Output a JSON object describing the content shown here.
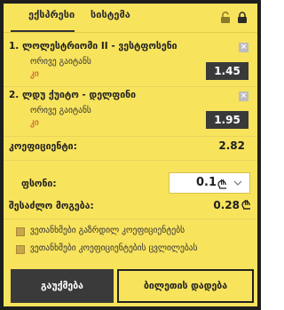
{
  "tabs": {
    "express": "ექსპრესი",
    "system": "სისტემა"
  },
  "bets": [
    {
      "number": "1.",
      "title": "ლოლესტრიომი II - ვესტფოსენი",
      "market": "ორივე გაიტანს",
      "pick": "კი",
      "odds": "1.45"
    },
    {
      "number": "2.",
      "title": "ლდუ ქუიტო - დელფინი",
      "market": "ორივე გაიტანს",
      "pick": "კი",
      "odds": "1.95"
    }
  ],
  "remove_glyph": "×",
  "summary": {
    "coef_label": "კოეფიციენტი:",
    "coef_value": "2.82",
    "bonus_label": "ფსონი:",
    "bonus_value": "0.1",
    "win_label": "შესაძლო მოგება:",
    "win_value": "0.28"
  },
  "options": {
    "opt1": "ვეთანხმები გაზრდილ კოეფიციენტებს",
    "opt2": "ვეთანხმები კოეფიციენტების ცვლილებას"
  },
  "buttons": {
    "cancel": "გაუქმება",
    "place": "ბილეთის დადება"
  },
  "colors": {
    "panel": "#f8e35d",
    "dark": "#3a3a3a",
    "pick_red": "#c0392b"
  },
  "icons": [
    "lock-open-icon",
    "lock-closed-icon",
    "remove-icon",
    "lari-icon",
    "chevron-down-icon"
  ]
}
